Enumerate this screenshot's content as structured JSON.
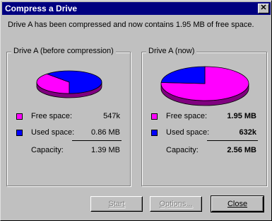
{
  "window": {
    "title": "Compress a Drive"
  },
  "message": "Drive A has been compressed and now contains 1.95 MB of free space.",
  "before": {
    "group_title": "Drive A (before compression)",
    "free_label": "Free space:",
    "free_value": "547k",
    "used_label": "Used space:",
    "used_value": "0.86 MB",
    "capacity_label": "Capacity:",
    "capacity_value": "1.39 MB",
    "free_fraction": 0.38
  },
  "after": {
    "group_title": "Drive A (now)",
    "free_label": "Free space:",
    "free_value": "1.95 MB",
    "used_label": "Used space:",
    "used_value": "632k",
    "capacity_label": "Capacity:",
    "capacity_value": "2.56 MB",
    "free_fraction": 0.76
  },
  "buttons": {
    "start": "Start",
    "options": "Options...",
    "close": "Close"
  },
  "colors": {
    "free": "#ff00ff",
    "used": "#0000ff",
    "free_dark": "#800080",
    "used_dark": "#000080",
    "titlebar": "#000080",
    "face": "#c0c0c0"
  },
  "icons": {
    "close": "close-icon"
  }
}
